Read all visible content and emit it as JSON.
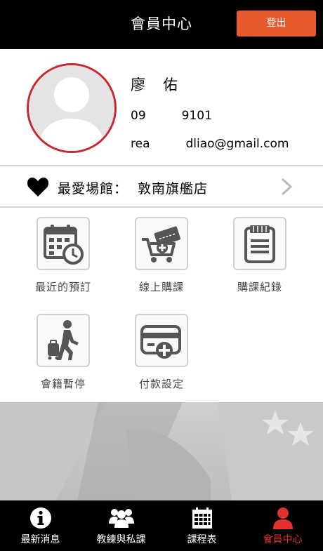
{
  "header": {
    "title": "會員中心",
    "logout_label": "登出"
  },
  "profile": {
    "name": "廖　佑",
    "phone": "09　　　9101",
    "email": "rea　　　dliao@gmail.com"
  },
  "favorite": {
    "label": "最愛場館：",
    "value": "敦南旗艦店"
  },
  "menu": [
    {
      "label": "最近的預訂",
      "icon": "calendar-clock-icon"
    },
    {
      "label": "線上購課",
      "icon": "cart-ticket-icon"
    },
    {
      "label": "購課紀錄",
      "icon": "receipt-icon"
    },
    {
      "label": "會籍暫停",
      "icon": "traveler-icon"
    },
    {
      "label": "付款設定",
      "icon": "credit-card-add-icon"
    }
  ],
  "tabs": [
    {
      "label": "最新消息",
      "icon": "info-icon",
      "active": false
    },
    {
      "label": "教練與私課",
      "icon": "group-icon",
      "active": false
    },
    {
      "label": "課程表",
      "icon": "schedule-icon",
      "active": false
    },
    {
      "label": "會員中心",
      "icon": "member-icon",
      "active": true
    }
  ],
  "colors": {
    "header_bg": "#000000",
    "accent": "#e75a2e",
    "avatar_border": "#c9262e",
    "tab_active": "#e0312f",
    "tab_inactive": "#ffffff",
    "icon_gray": "#555555"
  }
}
